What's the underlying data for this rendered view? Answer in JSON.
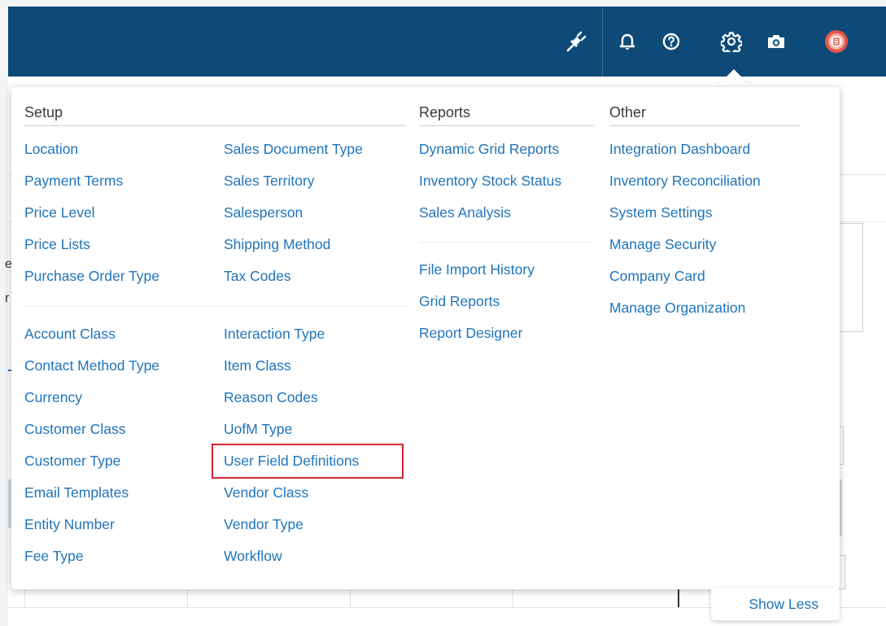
{
  "header": {
    "icons": [
      "plug-icon",
      "bell-icon",
      "help-icon",
      "gear-icon",
      "camera-icon",
      "avatar"
    ],
    "accent_color": "#0d4a78"
  },
  "menu": {
    "setup": {
      "title": "Setup",
      "col1_group1": [
        "Location",
        "Payment Terms",
        "Price Level",
        "Price Lists",
        "Purchase Order Type"
      ],
      "col2_group1": [
        "Sales Document Type",
        "Sales Territory",
        "Salesperson",
        "Shipping Method",
        "Tax Codes"
      ],
      "col1_group2": [
        "Account Class",
        "Contact Method Type",
        "Currency",
        "Customer Class",
        "Customer Type",
        "Email Templates",
        "Entity Number",
        "Fee Type"
      ],
      "col2_group2": [
        "Interaction Type",
        "Item Class",
        "Reason Codes",
        "UofM Type",
        "User Field Definitions",
        "Vendor Class",
        "Vendor Type",
        "Workflow"
      ]
    },
    "reports": {
      "title": "Reports",
      "group1": [
        "Dynamic Grid Reports",
        "Inventory Stock Status",
        "Sales Analysis"
      ],
      "group2": [
        "File Import History",
        "Grid Reports",
        "Report Designer"
      ]
    },
    "other": {
      "title": "Other",
      "items": [
        "Integration Dashboard",
        "Inventory Reconciliation",
        "System Settings",
        "Manage Security",
        "Company Card",
        "Manage Organization"
      ]
    },
    "highlighted_item": "User Field Definitions",
    "link_color": "#1f74bb",
    "highlight_color": "#d9232e"
  },
  "footer": {
    "show_less": "Show Less"
  },
  "background": {
    "partial_text_1": "e",
    "partial_text_2": "r"
  }
}
